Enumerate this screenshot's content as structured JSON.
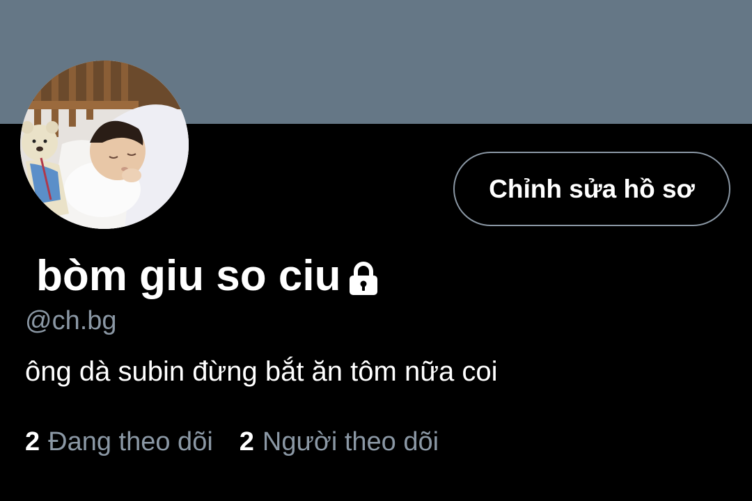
{
  "profile": {
    "display_name": "bòm giu so ciu",
    "handle": "@ch.bg",
    "bio": "ông dà subin đừng bắt ăn tôm nữa coi",
    "protected_icon": "lock-icon",
    "avatar_description": "avatar"
  },
  "actions": {
    "edit_profile_label": "Chỉnh sửa hồ sơ"
  },
  "stats": {
    "following_count": "2",
    "following_label": "Đang theo dõi",
    "followers_count": "2",
    "followers_label": "Người theo dõi"
  },
  "colors": {
    "banner": "#657786",
    "background": "#000000",
    "secondary_text": "#8b98a5",
    "primary_text": "#ffffff",
    "button_border": "#8b98a5"
  }
}
